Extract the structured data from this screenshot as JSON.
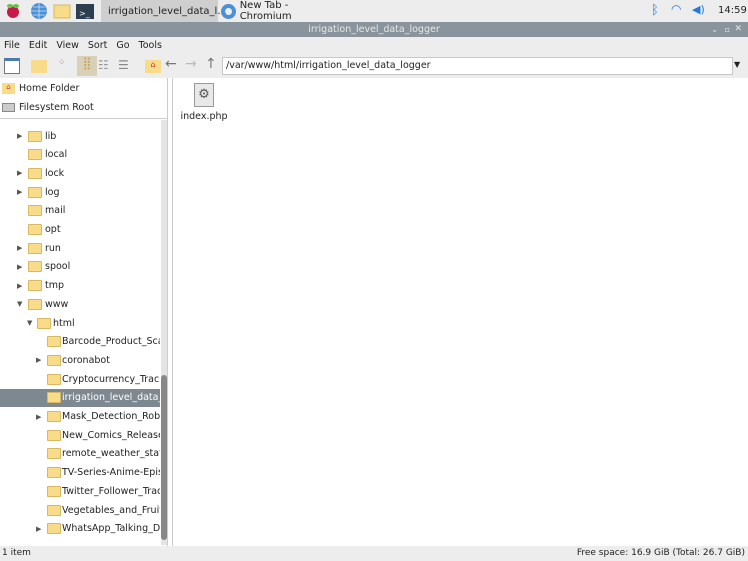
{
  "taskbar": {
    "tasks": [
      "irrigation_level_data_l...",
      "New Tab - Chromium"
    ],
    "clock": "14:59"
  },
  "window": {
    "title": "irrigation_level_data_logger"
  },
  "menu": [
    "File",
    "Edit",
    "View",
    "Sort",
    "Go",
    "Tools"
  ],
  "path": "/var/www/html/irrigation_level_data_logger",
  "places": [
    "Home Folder",
    "Filesystem Root"
  ],
  "tree": [
    {
      "label": "lib",
      "level": 1,
      "arrow": true
    },
    {
      "label": "local",
      "level": 1,
      "arrow": false
    },
    {
      "label": "lock",
      "level": 1,
      "arrow": true
    },
    {
      "label": "log",
      "level": 1,
      "arrow": true
    },
    {
      "label": "mail",
      "level": 1,
      "arrow": false
    },
    {
      "label": "opt",
      "level": 1,
      "arrow": false
    },
    {
      "label": "run",
      "level": 1,
      "arrow": true
    },
    {
      "label": "spool",
      "level": 1,
      "arrow": true
    },
    {
      "label": "tmp",
      "level": 1,
      "arrow": true
    },
    {
      "label": "www",
      "level": 1,
      "arrow": true,
      "open": true
    },
    {
      "label": "html",
      "level": 2,
      "arrow": true,
      "open": true
    },
    {
      "label": "Barcode_Product_Scanner",
      "level": 3,
      "arrow": false
    },
    {
      "label": "coronabot",
      "level": 3,
      "arrow": true
    },
    {
      "label": "Cryptocurrency_Tracker",
      "level": 3,
      "arrow": false
    },
    {
      "label": "irrigation_level_data_logger",
      "level": 3,
      "arrow": false,
      "selected": true
    },
    {
      "label": "Mask_Detection_Robot_",
      "level": 3,
      "arrow": true
    },
    {
      "label": "New_Comics_Releases",
      "level": 3,
      "arrow": false
    },
    {
      "label": "remote_weather_station",
      "level": 3,
      "arrow": false
    },
    {
      "label": "TV-Series-Anime-Episodes",
      "level": 3,
      "arrow": false
    },
    {
      "label": "Twitter_Follower_Tracker",
      "level": 3,
      "arrow": false
    },
    {
      "label": "Vegetables_and_Fruits_",
      "level": 3,
      "arrow": false
    },
    {
      "label": "WhatsApp_Talking_Door",
      "level": 3,
      "arrow": true
    }
  ],
  "files": [
    {
      "name": "index.php"
    }
  ],
  "status": {
    "left": "1 item",
    "right": "Free space: 16.9 GiB (Total: 26.7 GiB)"
  }
}
